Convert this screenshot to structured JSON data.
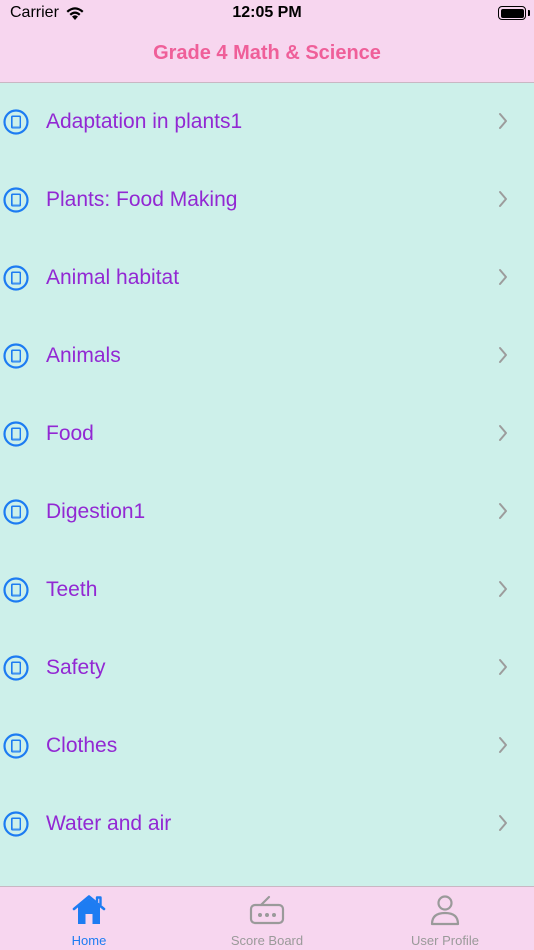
{
  "status_bar": {
    "carrier": "Carrier",
    "time": "12:05 PM"
  },
  "nav": {
    "title": "Grade 4 Math & Science"
  },
  "colors": {
    "accent_pink": "#ef5f99",
    "item_purple": "#9228d3",
    "icon_blue": "#1d7cf2",
    "chevron_gray": "#9c9c9c",
    "tab_active": "#1d7cf2",
    "tab_inactive": "#9a9a9a",
    "bar_background": "#f7d6ef",
    "list_background": "#cdf0ea"
  },
  "list": {
    "items": [
      {
        "label": "Adaptation in plants1",
        "icon": "book-icon"
      },
      {
        "label": "Plants: Food Making",
        "icon": "book-icon"
      },
      {
        "label": "Animal habitat",
        "icon": "book-icon"
      },
      {
        "label": "Animals",
        "icon": "book-icon"
      },
      {
        "label": "Food",
        "icon": "book-icon"
      },
      {
        "label": "Digestion1",
        "icon": "book-icon"
      },
      {
        "label": "Teeth",
        "icon": "book-icon"
      },
      {
        "label": "Safety",
        "icon": "book-icon"
      },
      {
        "label": "Clothes",
        "icon": "book-icon"
      },
      {
        "label": "Water and air",
        "icon": "book-icon"
      }
    ]
  },
  "tabs": [
    {
      "label": "Home",
      "icon": "home-icon",
      "active": true
    },
    {
      "label": "Score Board",
      "icon": "scoreboard-icon",
      "active": false
    },
    {
      "label": "User Profile",
      "icon": "user-icon",
      "active": false
    }
  ]
}
